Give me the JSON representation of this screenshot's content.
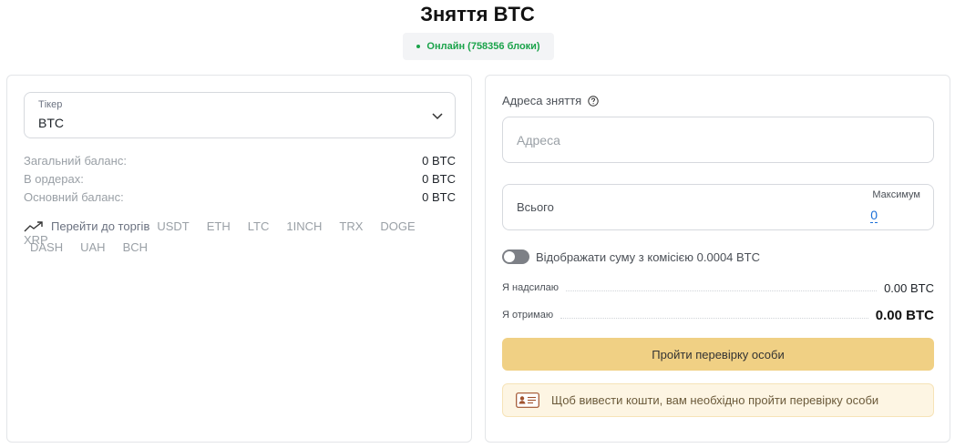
{
  "page": {
    "title": "Зняття BTC",
    "status": "Онлайн (758356 блоки)"
  },
  "left": {
    "ticker_label": "Тікер",
    "ticker_value": "BTC",
    "balances": [
      {
        "label": "Загальний баланс:",
        "value": "0 BTC"
      },
      {
        "label": "В ордерах:",
        "value": "0 BTC"
      },
      {
        "label": "Основний баланс:",
        "value": "0 BTC"
      }
    ],
    "trade_label": "Перейти до торгів",
    "pairs": [
      "USDT",
      "ETH",
      "LTC",
      "1INCH",
      "TRX",
      "DOGE",
      "XRP",
      "DASH",
      "UAH",
      "BCH"
    ]
  },
  "right": {
    "address_label": "Адреса зняття",
    "address_placeholder": "Адреса",
    "amount_label": "Всього",
    "max_label": "Максимум",
    "max_value": "0",
    "toggle_text": "Відображати суму з комісією 0.0004 BTC",
    "toggle_on": false,
    "send_label": "Я надсилаю",
    "send_value": "0.00 BTC",
    "receive_label": "Я отримаю",
    "receive_value": "0.00 BTC",
    "verify_button": "Пройти перевірку особи",
    "notice_text": "Щоб вивести кошти, вам необхідно пройти перевірку особи"
  },
  "colors": {
    "online": "#1aa34a",
    "accent_button": "#f0d084",
    "notice_bg": "#fdf5e3",
    "link": "#1a6fd8"
  },
  "icons": [
    "chevron-down-icon",
    "trend-up-icon",
    "help-icon",
    "id-card-icon"
  ]
}
